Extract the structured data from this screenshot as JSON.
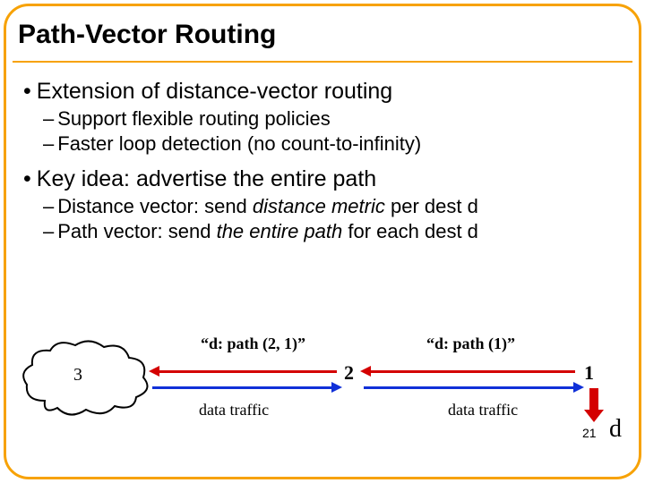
{
  "title": "Path-Vector Routing",
  "bullets": {
    "b1a": "Extension of distance-vector routing",
    "b2a": "Support flexible routing policies",
    "b2b": "Faster loop detection (no count-to-infinity)",
    "b1b": "Key idea: advertise the entire path",
    "b2c_pre": "Distance vector: send ",
    "b2c_em": "distance metric",
    "b2c_post": " per dest d",
    "b2d_pre": "Path vector: send ",
    "b2d_em": "the entire path",
    "b2d_post": " for each dest d"
  },
  "diagram": {
    "cloud_label": "3",
    "node2": "2",
    "node1": "1",
    "path21": "“d: path (2, 1)”",
    "path1": "“d: path (1)”",
    "traffic": "data traffic",
    "dest": "d",
    "pagenum": "21"
  }
}
